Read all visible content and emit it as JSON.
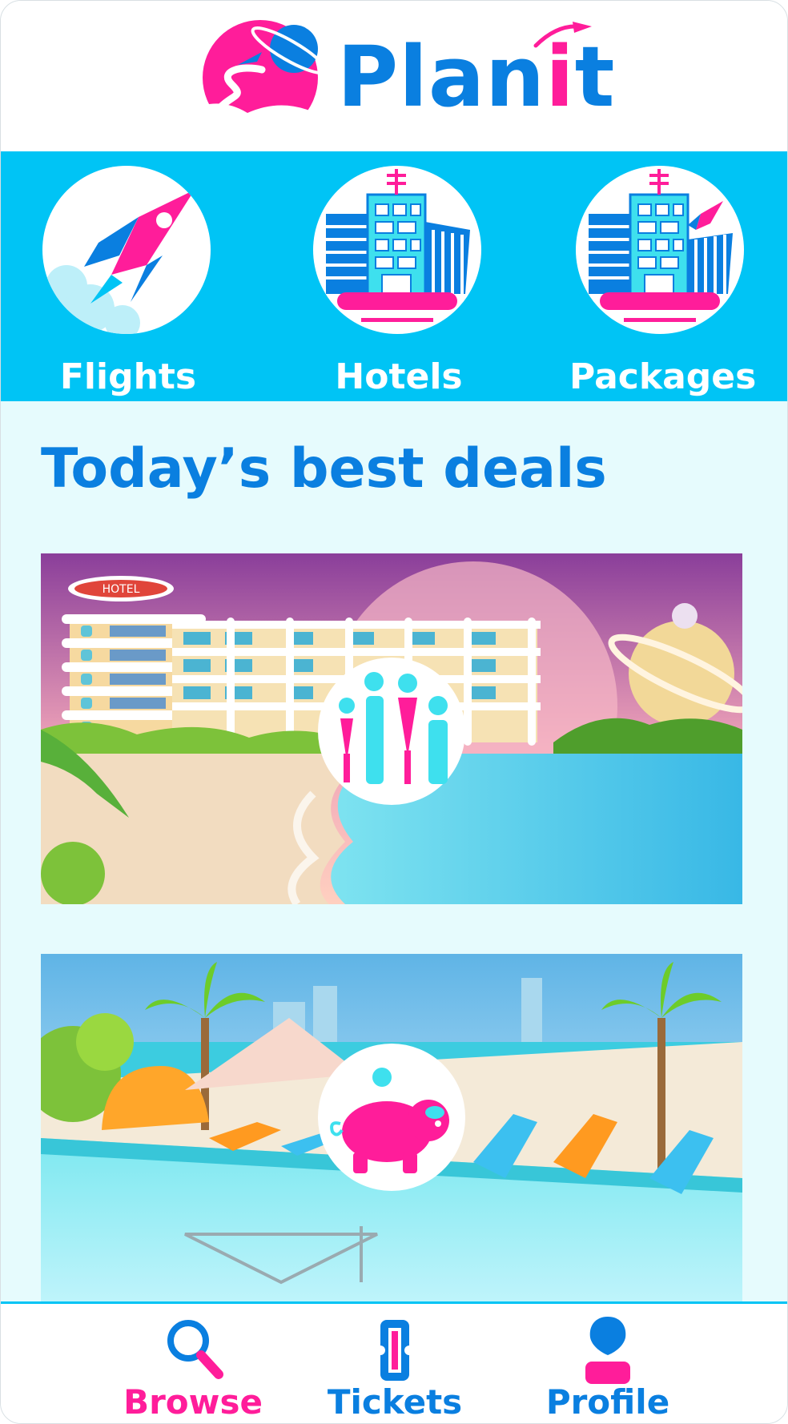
{
  "app": {
    "logo_text_part1": "Plan",
    "logo_text_part2": "i",
    "logo_text_part3": "t",
    "brand_blue": "#0a7fe0",
    "brand_pink": "#ff1d9a",
    "band_cyan": "#00c4f5"
  },
  "categories": [
    {
      "label": "Flights",
      "icon": "rocket-icon"
    },
    {
      "label": "Hotels",
      "icon": "hotel-icon"
    },
    {
      "label": "Packages",
      "icon": "package-icon"
    }
  ],
  "main": {
    "section_title": "Today’s best deals",
    "deals": [
      {
        "icon": "family-icon",
        "scene": "beach-hotel"
      },
      {
        "icon": "piggy-bank-icon",
        "scene": "pool-resort"
      }
    ],
    "hotel_sign": "HOTEL"
  },
  "bottom_nav": {
    "items": [
      {
        "label": "Browse",
        "icon": "search-icon",
        "active": true
      },
      {
        "label": "Tickets",
        "icon": "ticket-icon",
        "active": false
      },
      {
        "label": "Profile",
        "icon": "profile-icon",
        "active": false
      }
    ]
  }
}
